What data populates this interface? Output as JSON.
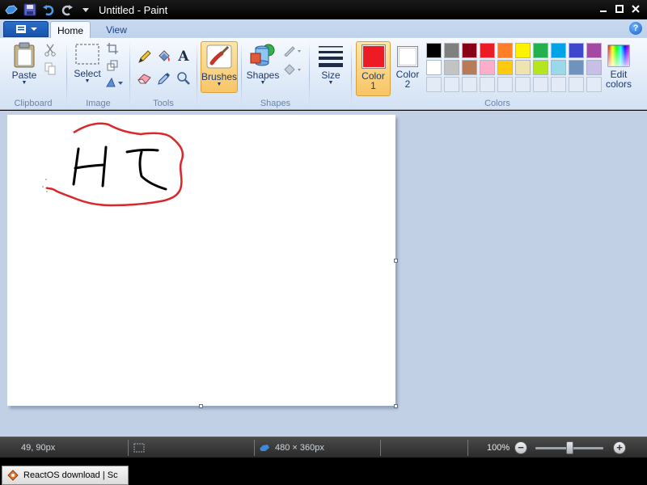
{
  "window": {
    "title": "Untitled - Paint"
  },
  "ribbon": {
    "tabs": [
      {
        "label": "Home"
      },
      {
        "label": "View"
      }
    ],
    "help": "?",
    "groups": {
      "clipboard": {
        "label": "Clipboard",
        "paste": "Paste"
      },
      "image": {
        "label": "Image",
        "select": "Select"
      },
      "tools": {
        "label": "Tools",
        "text_tool": "A"
      },
      "brushes": {
        "label": "Brushes"
      },
      "shapes": {
        "label": "Shapes",
        "button": "Shapes"
      },
      "size": {
        "label": "Size"
      },
      "colors": {
        "label": "Colors",
        "color1_label": "Color",
        "color1_num": "1",
        "color2_label": "Color",
        "color2_num": "2",
        "edit_label": "Edit",
        "edit_label2": "colors",
        "color1": "#ed1c24",
        "color2": "#ffffff",
        "palette_row1": [
          "#000000",
          "#7f7f7f",
          "#880015",
          "#ed1c24",
          "#ff7f27",
          "#fff200",
          "#22b14c",
          "#00a2e8",
          "#3f48cc",
          "#a349a4"
        ],
        "palette_row2": [
          "#ffffff",
          "#c3c3c3",
          "#b97a57",
          "#ffaec9",
          "#ffc90e",
          "#efe4b0",
          "#b5e61d",
          "#99d9ea",
          "#7092be",
          "#c8bfe7"
        ]
      }
    }
  },
  "canvas": {
    "drawing_text": "HI",
    "outline_color": "#d8282c",
    "ink_color": "#000000"
  },
  "statusbar": {
    "cursor_pos": "49, 90px",
    "image_size": "480 × 360px",
    "zoom": "100%",
    "zoom_level": 1.0
  },
  "taskbar": {
    "item": "ReactOS download | Sc"
  }
}
